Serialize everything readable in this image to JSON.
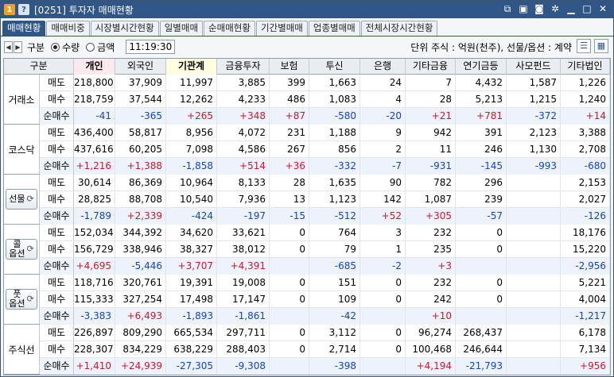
{
  "window": {
    "badge1": "1",
    "badge2": "?",
    "title": "[0251] 투자자 매매현황"
  },
  "titlebar_icons": [
    "window-link-icon",
    "save-icon",
    "camera-icon",
    "gear-icon",
    "minimize-icon",
    "maximize-icon",
    "close-icon"
  ],
  "tabs": [
    "매매현황",
    "매매비중",
    "시장별시간현황",
    "일별매매",
    "순매매현황",
    "기간별매매",
    "업종별매매",
    "전체시장시간현황"
  ],
  "toolbar": {
    "gubun_label": "구분",
    "radio_quantity": "수량",
    "radio_amount": "금액",
    "time": "11:19:30",
    "unit": "단위 주식 : 억원(천주), 선물/옵션 : 계약"
  },
  "columns": [
    "구분",
    "",
    "개인",
    "외국인",
    "기관계",
    "금융투자",
    "보험",
    "투신",
    "은행",
    "기타금융",
    "연기금등",
    "사모펀드",
    "기타법인"
  ],
  "groups": [
    {
      "name": "거래소",
      "button": false,
      "rows": [
        {
          "label": "매도",
          "values": [
            "218,800",
            "37,909",
            "11,997",
            "3,885",
            "399",
            "1,663",
            "24",
            "7",
            "4,432",
            "1,587",
            "1,226"
          ]
        },
        {
          "label": "매수",
          "values": [
            "218,759",
            "37,544",
            "12,262",
            "4,233",
            "486",
            "1,083",
            "4",
            "28",
            "5,213",
            "1,215",
            "1,240"
          ]
        },
        {
          "label": "순매수",
          "values": [
            "-41",
            "-365",
            "+265",
            "+348",
            "+87",
            "-580",
            "-20",
            "+21",
            "+781",
            "-372",
            "+14"
          ]
        }
      ]
    },
    {
      "name": "코스닥",
      "button": false,
      "rows": [
        {
          "label": "매도",
          "values": [
            "436,400",
            "58,817",
            "8,956",
            "4,072",
            "231",
            "1,188",
            "9",
            "942",
            "391",
            "2,123",
            "3,388"
          ]
        },
        {
          "label": "매수",
          "values": [
            "437,616",
            "60,205",
            "7,098",
            "4,586",
            "267",
            "856",
            "2",
            "11",
            "246",
            "1,130",
            "2,708"
          ]
        },
        {
          "label": "순매수",
          "values": [
            "+1,216",
            "+1,388",
            "-1,858",
            "+514",
            "+36",
            "-332",
            "-7",
            "-931",
            "-145",
            "-993",
            "-680"
          ]
        }
      ]
    },
    {
      "name": "선물",
      "button": true,
      "rows": [
        {
          "label": "매도",
          "values": [
            "30,614",
            "86,369",
            "10,964",
            "8,133",
            "28",
            "1,635",
            "90",
            "782",
            "296",
            "",
            "2,153"
          ]
        },
        {
          "label": "매수",
          "values": [
            "28,825",
            "88,708",
            "10,540",
            "7,936",
            "13",
            "1,123",
            "142",
            "1,087",
            "239",
            "",
            "2,027"
          ]
        },
        {
          "label": "순매수",
          "values": [
            "-1,789",
            "+2,339",
            "-424",
            "-197",
            "-15",
            "-512",
            "+52",
            "+305",
            "-57",
            "",
            "-126"
          ]
        }
      ]
    },
    {
      "name": "콜\n옵션",
      "button": true,
      "rows": [
        {
          "label": "매도",
          "values": [
            "152,034",
            "344,392",
            "34,620",
            "33,621",
            "0",
            "764",
            "3",
            "232",
            "0",
            "",
            "18,176"
          ]
        },
        {
          "label": "매수",
          "values": [
            "156,729",
            "338,946",
            "38,327",
            "38,012",
            "0",
            "79",
            "1",
            "235",
            "0",
            "",
            "15,220"
          ]
        },
        {
          "label": "순매수",
          "values": [
            "+4,695",
            "-5,446",
            "+3,707",
            "+4,391",
            "",
            "-685",
            "-2",
            "+3",
            "",
            "",
            "-2,956"
          ]
        }
      ]
    },
    {
      "name": "풋\n옵션",
      "button": true,
      "rows": [
        {
          "label": "매도",
          "values": [
            "118,716",
            "320,761",
            "19,391",
            "19,008",
            "0",
            "151",
            "0",
            "232",
            "0",
            "",
            "5,221"
          ]
        },
        {
          "label": "매수",
          "values": [
            "115,333",
            "327,254",
            "17,498",
            "17,147",
            "0",
            "109",
            "0",
            "242",
            "0",
            "",
            "4,004"
          ]
        },
        {
          "label": "순매수",
          "values": [
            "-3,383",
            "+6,493",
            "-1,893",
            "-1,861",
            "",
            "-42",
            "",
            "+10",
            "",
            "",
            "-1,217"
          ]
        }
      ]
    },
    {
      "name": "주식선",
      "button": false,
      "rows": [
        {
          "label": "매도",
          "values": [
            "226,897",
            "809,290",
            "665,534",
            "297,711",
            "0",
            "3,112",
            "0",
            "96,274",
            "268,437",
            "",
            "6,178"
          ]
        },
        {
          "label": "매수",
          "values": [
            "228,307",
            "834,229",
            "638,229",
            "288,403",
            "0",
            "2,714",
            "0",
            "100,468",
            "246,644",
            "",
            "7,134"
          ]
        },
        {
          "label": "순매수",
          "values": [
            "+1,410",
            "+24,939",
            "-27,305",
            "-9,308",
            "",
            "-398",
            "",
            "+4,194",
            "-21,793",
            "",
            "+956"
          ]
        }
      ]
    }
  ]
}
